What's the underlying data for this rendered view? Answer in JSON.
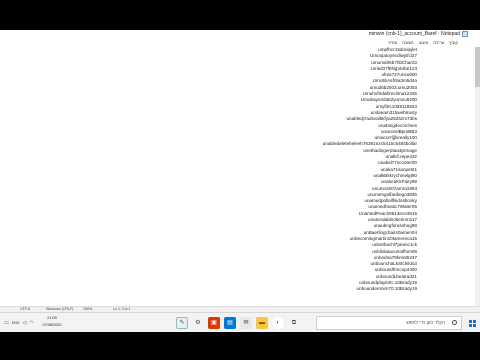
{
  "window": {
    "title": "minwin (cnb-1)_account_Baref - Notepad",
    "menu": [
      "קובץ",
      "עריכה",
      "עיצוב",
      "תצוגה",
      "עזרה"
    ]
  },
  "lines": [
    "umpfhcr15dooipjlet",
    "Umoopaoyecdiwjsfcl27",
    "umumalr5b7hbChar23",
    "Umkd37f8NgVerbe123",
    "ufras727unsu600",
    "Umc6bAsfr9a3m5d4a",
    "umud5b2003.umu2003",
    "Umuhofirdwfireclima12345",
    "Umubayorida52yumxu6200",
    "umyfitrc1068118823",
    "unitaeam315webtrusty",
    "unabledj7adsvalbkfya2526zm73bs",
    "unabingdecorchies",
    "unacorelBproBB3",
    "umacorrfjjfxreally100",
    "unabledeleteheleeh78391e2c5415c5484bollar",
    "unethadingerptaa3prmage",
    "unalkfi.repe432",
    "unakal77scooter00",
    "unaka71sanpet21",
    "unalkBkkrychmelgt90",
    "unaloraKkFairy99",
    "unumn2007amra1993",
    "unumengolfardiego3836",
    "unamedpollallfsidosbooky",
    "unamedheatic7Water05",
    "UnamedPeach9513ece3615",
    "unaturalablookerinm117",
    "unaubngforusohog88",
    "unBaerlingchairs0amen04",
    "unbecomingmartin10tamereca15",
    "unbethachl7peanc1ck",
    "unbilolatacurtoiffom09",
    "unbodna78kmet5247",
    "unbounchaLkStchildo3",
    "unboundfrmcop4400",
    "unboundLbeatrad21",
    "unboundplayit4C.10Brady19",
    "unbounderonim70.10Brady19"
  ],
  "statusbar": {
    "encoding": "UTF-8",
    "line_ending": "Windows (CRLF)",
    "zoom": "100%",
    "position": "Ln 1, Col 1"
  },
  "taskbar": {
    "clock_time": "21:09",
    "clock_date": "07/08/2020",
    "search_placeholder": "הקלד כאן כדי לחפש",
    "keyboard_lang": "ENG"
  },
  "colors": {
    "start_blue": "#1f6fd1",
    "taskbar_bg": "#f3f3f3"
  }
}
